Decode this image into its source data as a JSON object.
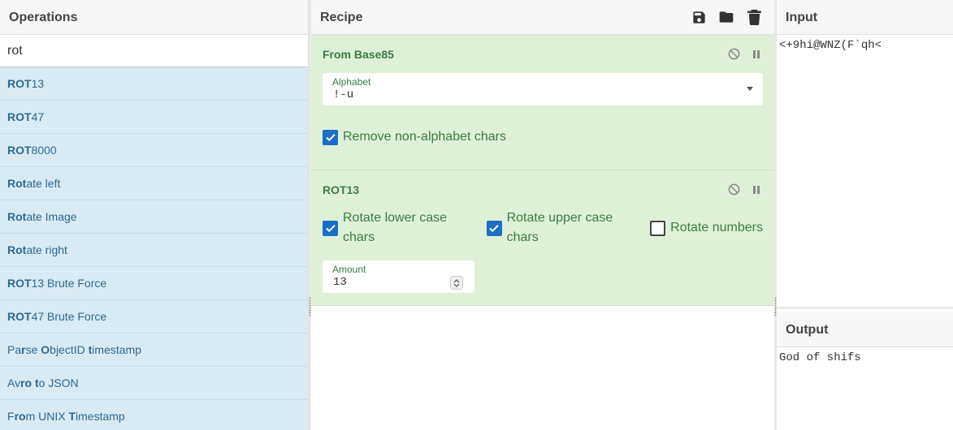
{
  "operations": {
    "title": "Operations",
    "search_value": "rot",
    "items": [
      {
        "parts": [
          {
            "t": "ROT",
            "b": true
          },
          {
            "t": "13",
            "b": false
          }
        ]
      },
      {
        "parts": [
          {
            "t": "ROT",
            "b": true
          },
          {
            "t": "47",
            "b": false
          }
        ]
      },
      {
        "parts": [
          {
            "t": "ROT",
            "b": true
          },
          {
            "t": "8000",
            "b": false
          }
        ]
      },
      {
        "parts": [
          {
            "t": "Rot",
            "b": true
          },
          {
            "t": "ate left",
            "b": false
          }
        ]
      },
      {
        "parts": [
          {
            "t": "Rot",
            "b": true
          },
          {
            "t": "ate Image",
            "b": false
          }
        ]
      },
      {
        "parts": [
          {
            "t": "Rot",
            "b": true
          },
          {
            "t": "ate right",
            "b": false
          }
        ]
      },
      {
        "parts": [
          {
            "t": "ROT",
            "b": true
          },
          {
            "t": "13 Brute Force",
            "b": false
          }
        ]
      },
      {
        "parts": [
          {
            "t": "ROT",
            "b": true
          },
          {
            "t": "47 Brute Force",
            "b": false
          }
        ]
      },
      {
        "parts": [
          {
            "t": "Pa",
            "b": false
          },
          {
            "t": "r",
            "b": true
          },
          {
            "t": "se ",
            "b": false
          },
          {
            "t": "O",
            "b": true
          },
          {
            "t": "bjectID ",
            "b": false
          },
          {
            "t": "t",
            "b": true
          },
          {
            "t": "imestamp",
            "b": false
          }
        ]
      },
      {
        "parts": [
          {
            "t": "Av",
            "b": false
          },
          {
            "t": "ro",
            "b": true
          },
          {
            "t": " ",
            "b": false
          },
          {
            "t": "t",
            "b": true
          },
          {
            "t": "o JSON",
            "b": false
          }
        ]
      },
      {
        "parts": [
          {
            "t": "F",
            "b": false
          },
          {
            "t": "ro",
            "b": true
          },
          {
            "t": "m UNIX ",
            "b": false
          },
          {
            "t": "T",
            "b": true
          },
          {
            "t": "imestamp",
            "b": false
          }
        ]
      }
    ]
  },
  "recipe": {
    "title": "Recipe",
    "toolbar_icons": [
      "save-icon",
      "folder-icon",
      "trash-icon"
    ],
    "from_base85": {
      "name": "From Base85",
      "alphabet_label": "Alphabet",
      "alphabet_value": "!-u",
      "remove_label": "Remove non-alphabet chars",
      "remove_checked": true
    },
    "rot13": {
      "name": "ROT13",
      "lower_label": "Rotate lower case chars",
      "lower_checked": true,
      "upper_label": "Rotate upper case chars",
      "upper_checked": true,
      "numbers_label": "Rotate numbers",
      "numbers_checked": false,
      "amount_label": "Amount",
      "amount_value": "13"
    }
  },
  "input": {
    "title": "Input",
    "value": "<+9hi@WNZ(F`qh<"
  },
  "output": {
    "title": "Output",
    "value": "God of shifs"
  },
  "colors": {
    "accent": "#1a6fc4",
    "op_bg": "#d9eaf3",
    "recipe_bg": "#dff0d8",
    "recipe_text": "#3a7d44"
  }
}
